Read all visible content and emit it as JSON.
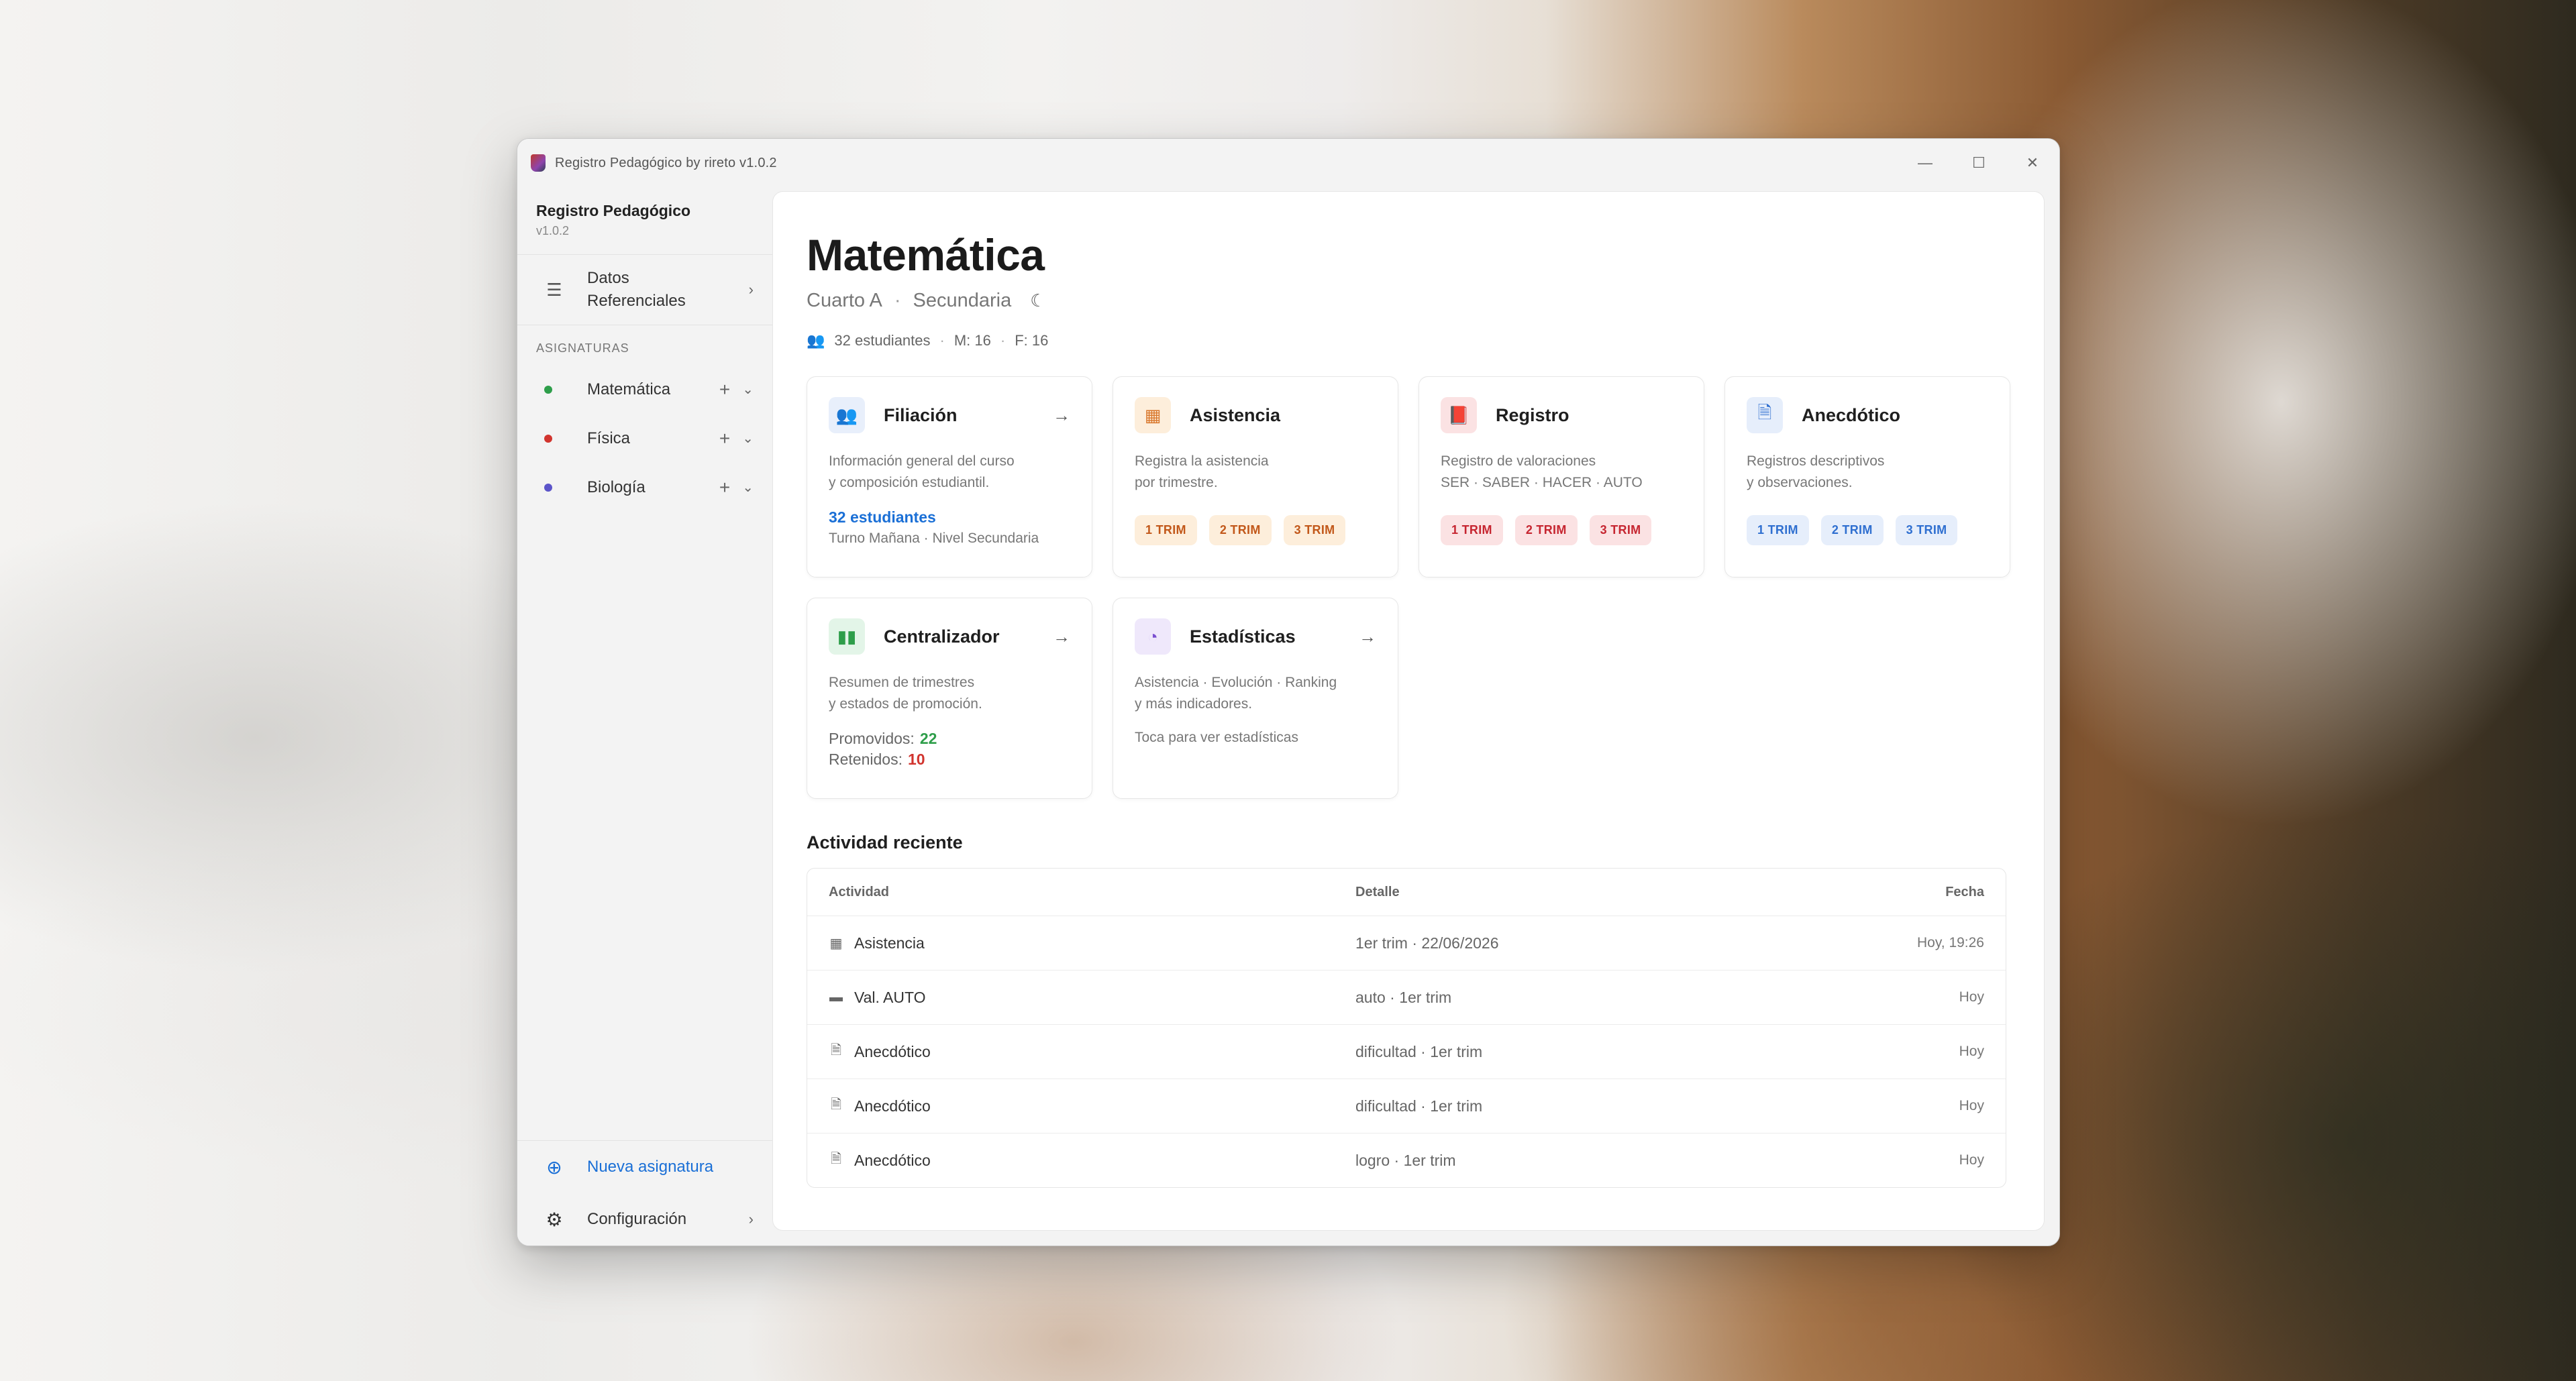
{
  "window": {
    "title": "Registro Pedagógico by rireto v1.0.2",
    "controls": {
      "minimize": "—",
      "maximize": "☐",
      "close": "✕"
    }
  },
  "sidebar": {
    "app_name": "Registro Pedagógico",
    "version": "v1.0.2",
    "datos_label": "Datos\nReferenciales",
    "section_label": "ASIGNATURAS",
    "subjects": [
      {
        "label": "Matemática",
        "color": "#2e9e4a"
      },
      {
        "label": "Física",
        "color": "#d1342e"
      },
      {
        "label": "Biología",
        "color": "#5b54c9"
      }
    ],
    "new_subject_label": "Nueva asignatura",
    "settings_label": "Configuración"
  },
  "main": {
    "title": "Matemática",
    "course": "Cuarto A",
    "level": "Secundaria",
    "students": "32 estudiantes",
    "males": "M: 16",
    "females": "F: 16",
    "cards": {
      "filiacion": {
        "title": "Filiación",
        "desc": "Información general del curso\ny composición estudiantil.",
        "highlight": "32 estudiantes",
        "sub": "Turno Mañana · Nivel Secundaria"
      },
      "asistencia": {
        "title": "Asistencia",
        "desc": "Registra la asistencia\npor trimestre.",
        "chips": [
          "1 TRIM",
          "2 TRIM",
          "3 TRIM"
        ]
      },
      "registro": {
        "title": "Registro",
        "desc": "Registro de valoraciones\nSER · SABER · HACER · AUTO",
        "chips": [
          "1 TRIM",
          "2 TRIM",
          "3 TRIM"
        ]
      },
      "anecdotico": {
        "title": "Anecdótico",
        "desc": "Registros descriptivos\ny observaciones.",
        "chips": [
          "1 TRIM",
          "2 TRIM",
          "3 TRIM"
        ]
      },
      "centralizador": {
        "title": "Centralizador",
        "desc": "Resumen de trimestres\ny estados de promoción.",
        "promoted_label": "Promovidos:",
        "promoted_value": "22",
        "retained_label": "Retenidos:",
        "retained_value": "10"
      },
      "estadisticas": {
        "title": "Estadísticas",
        "desc": "Asistencia · Evolución · Ranking\ny más indicadores.",
        "hint": "Toca para ver estadísticas"
      }
    },
    "activity": {
      "title": "Actividad reciente",
      "headers": {
        "activity": "Actividad",
        "detail": "Detalle",
        "date": "Fecha"
      },
      "rows": [
        {
          "icon": "calendar-icon",
          "activity": "Asistencia",
          "detail": "1er trim · 22/06/2026",
          "date": "Hoy, 19:26"
        },
        {
          "icon": "book-icon",
          "activity": "Val. AUTO",
          "detail": "auto · 1er trim",
          "date": "Hoy"
        },
        {
          "icon": "document-icon",
          "activity": "Anecdótico",
          "detail": "dificultad · 1er trim",
          "date": "Hoy"
        },
        {
          "icon": "document-icon",
          "activity": "Anecdótico",
          "detail": "dificultad · 1er trim",
          "date": "Hoy"
        },
        {
          "icon": "document-icon",
          "activity": "Anecdótico",
          "detail": "logro · 1er trim",
          "date": "Hoy"
        }
      ]
    }
  }
}
